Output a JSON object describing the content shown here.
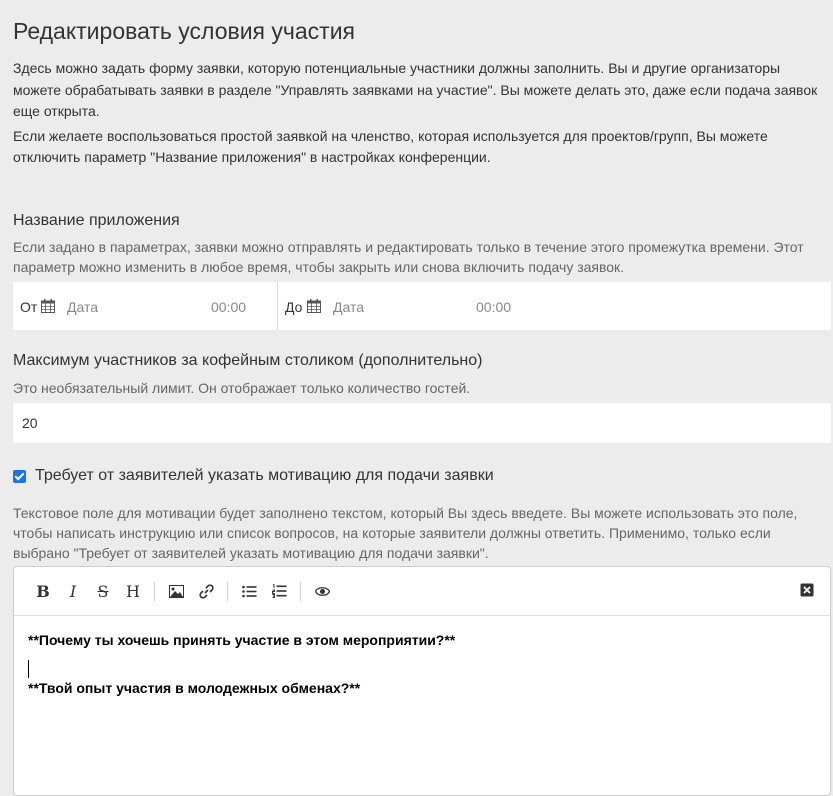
{
  "page": {
    "title": "Редактировать условия участия",
    "intro_p1": "Здесь можно задать форму заявки, которую потенциальные участники должны заполнить. Вы и другие организаторы можете обрабатывать заявки в разделе \"Управлять заявками на участие\". Вы можете делать это, даже если подача заявок еще открыта.",
    "intro_p2": "Если желаете воспользоваться простой заявкой на членство, которая используется для проектов/групп, Вы можете отключить параметр \"Название приложения\" в настройках конференции."
  },
  "application_name": {
    "label": "Название приложения",
    "help": "Если задано в параметрах, заявки можно отправлять и редактировать только в течение этого промежутка времени. Этот параметр можно изменить в любое время, чтобы закрыть или снова включить подачу заявок.",
    "from_label": "От",
    "to_label": "До",
    "date_placeholder": "Дата",
    "time_placeholder": "00:00"
  },
  "max_participants": {
    "label": "Максимум участников за кофейным столиком (дополнительно)",
    "help": "Это необязательный лимит. Он отображает только количество гостей.",
    "value": "20"
  },
  "motivation": {
    "checkbox_label": "Требует от заявителей указать мотивацию для подачи заявки",
    "checked": true,
    "help": "Текстовое поле для мотивации будет заполнено текстом, который Вы здесь введете. Вы можете использовать это поле, чтобы написать инструкцию или список вопросов, на которые заявители должны ответить. Применимо, только если выбрано \"Требует от заявителей указать мотивацию для подачи заявки\"."
  },
  "editor": {
    "toolbar": {
      "bold": "B",
      "italic": "I",
      "strike": "S",
      "heading": "H"
    },
    "content_line1": "**Почему ты хочешь принять участие в этом мероприятии?**",
    "content_line2": "**Твой опыт участия в молодежных обменах?**"
  },
  "colors": {
    "background": "#ececec",
    "accent": "#1a73e8"
  }
}
